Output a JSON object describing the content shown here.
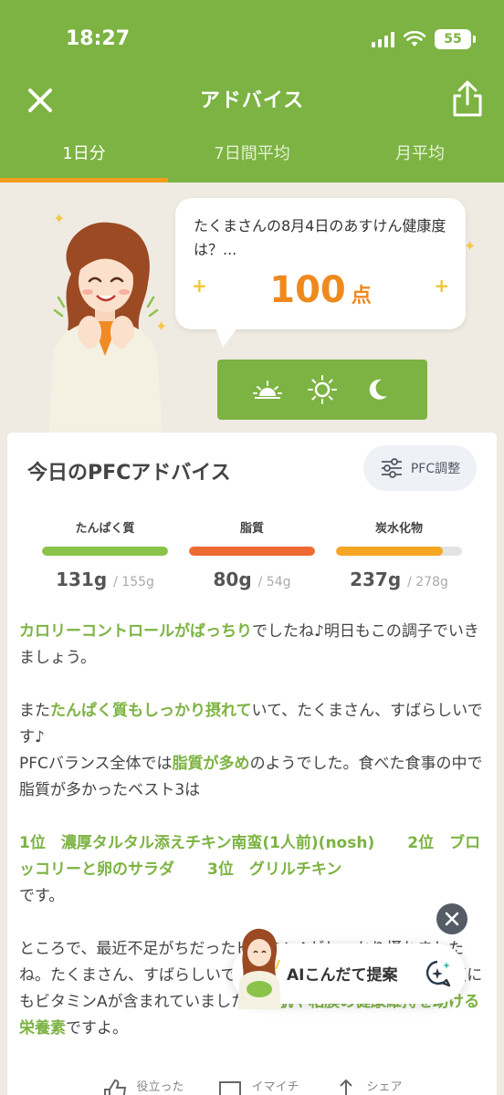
{
  "status_bar": {
    "time": "18:27",
    "battery": "55"
  },
  "header": {
    "title": "アドバイス"
  },
  "tabs": [
    {
      "label": "1日分",
      "active": true
    },
    {
      "label": "7日間平均",
      "active": false
    },
    {
      "label": "月平均",
      "active": false
    }
  ],
  "bubble": {
    "text": "たくまさんの8月4日のあすけん健康度は？...",
    "score": "100",
    "unit": "点"
  },
  "pfc": {
    "title": "今日のPFCアドバイス",
    "adjust_button": "PFC調整",
    "macros": [
      {
        "label": "たんぱく質",
        "value": "131g",
        "goal": "/ 155g",
        "progress": 1.0,
        "color": "#8bc34a"
      },
      {
        "label": "脂質",
        "value": "80g",
        "goal": "/ 54g",
        "progress": 1.0,
        "color": "#ee6a33"
      },
      {
        "label": "炭水化物",
        "value": "237g",
        "goal": "/ 278g",
        "progress": 0.85,
        "color": "#f5a623"
      }
    ]
  },
  "advice": {
    "p1_hl": "カロリーコントロールがばっちり",
    "p1_rest": "でしたね♪明日もこの調子でいきましょう。",
    "p2_a": "また",
    "p2_hl1": "たんぱく質もしっかり摂れて",
    "p2_b": "いて、たくまさん、すばらしいです♪",
    "p2_c": "PFCバランス全体では",
    "p2_hl2": "脂質が多め",
    "p2_d": "のようでした。食べた食事の中で脂質が多かったベスト3は",
    "rank1": "1位　濃厚タルタル添えチキン南蛮(1人前)(nosh)",
    "rank2": "2位　ブロッコリーと卵のサラダ",
    "rank3": "3位　グリルチキン",
    "desu": "です。",
    "p4_a": "ところで、最近不足がちだったビタミンAがしっかり摂れましたね。たくまさん、すばらしいです。",
    "p4_b": "濃厚タルタル添えチキン南蛮にもビタミンAが含まれていました。",
    "p4_hl": "お肌や粘膜の健康維持を助ける栄養素",
    "p4_c": "ですよ。"
  },
  "ai_button": {
    "label": "AIこんだて提案"
  },
  "footer": {
    "items": [
      "役立った",
      "イマイチ",
      "シェア"
    ]
  }
}
